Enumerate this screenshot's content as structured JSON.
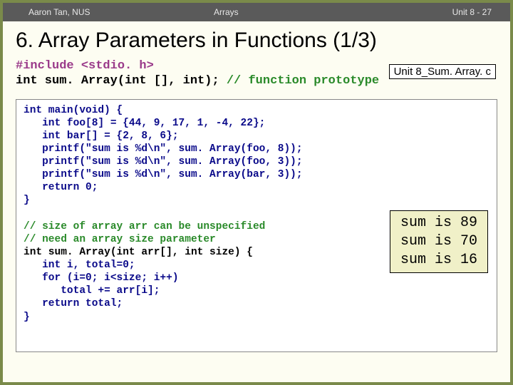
{
  "header": {
    "left": "Aaron Tan, NUS",
    "mid": "Arrays",
    "right": "Unit 8 - 27"
  },
  "title": "6. Array Parameters in Functions (1/3)",
  "filename": "Unit 8_Sum. Array. c",
  "proto": {
    "include": "#include <stdio. h>",
    "line1a": "int sum. Array(int [], int); ",
    "line1b": "// function prototype"
  },
  "code": {
    "l1": "int main(void) {",
    "l2": "   int foo[8] = {44, 9, 17, 1, -4, 22};",
    "l3": "   int bar[] = {2, 8, 6};",
    "l4": "   printf(\"sum is %d\\n\", sum. Array(foo, 8));",
    "l5": "   printf(\"sum is %d\\n\", sum. Array(foo, 3));",
    "l6": "   printf(\"sum is %d\\n\", sum. Array(bar, 3));",
    "l7": "   return 0;",
    "l8": "}",
    "c1": "// size of array arr can be unspecified",
    "c2": "// need an array size parameter",
    "f1": "int sum. Array(int arr[], int size) {",
    "f2": "   int i, total=0;",
    "f3": "   for (i=0; i<size; i++)",
    "f4": "      total += arr[i];",
    "f5": "   return total;",
    "f6": "}"
  },
  "output": {
    "o1": "sum is 89",
    "o2": "sum is 70",
    "o3": "sum is 16"
  },
  "chart_data": {
    "type": "table",
    "title": "Program output",
    "rows": [
      {
        "label": "sum is",
        "value": 89
      },
      {
        "label": "sum is",
        "value": 70
      },
      {
        "label": "sum is",
        "value": 16
      }
    ]
  }
}
